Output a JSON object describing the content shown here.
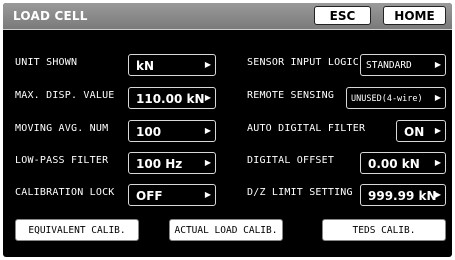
{
  "header": {
    "title": "LOAD CELL",
    "esc_label": "ESC",
    "home_label": "HOME"
  },
  "left": [
    {
      "label": "UNIT SHOWN",
      "value": "kN"
    },
    {
      "label": "MAX. DISP. VALUE",
      "value": "110.00 kN"
    },
    {
      "label": "MOVING AVG. NUM",
      "value": "100"
    },
    {
      "label": "LOW-PASS FILTER",
      "value": "100 Hz"
    },
    {
      "label": "CALIBRATION LOCK",
      "value": "OFF"
    }
  ],
  "right": [
    {
      "label": "SENSOR INPUT LOGIC",
      "value": "STANDARD"
    },
    {
      "label": "REMOTE SENSING",
      "value": "UNUSED(4-wire)"
    },
    {
      "label": "AUTO DIGITAL FILTER",
      "value": "ON"
    },
    {
      "label": "DIGITAL OFFSET",
      "value": "0.00 kN"
    },
    {
      "label": "D/Z LIMIT SETTING",
      "value": "999.99 kN"
    }
  ],
  "buttons": {
    "equivalent": "EQUIVALENT CALIB.",
    "actual": "ACTUAL LOAD CALIB.",
    "teds": "TEDS CALIB."
  },
  "icons": {
    "dropdown": "triangle-right-icon"
  }
}
